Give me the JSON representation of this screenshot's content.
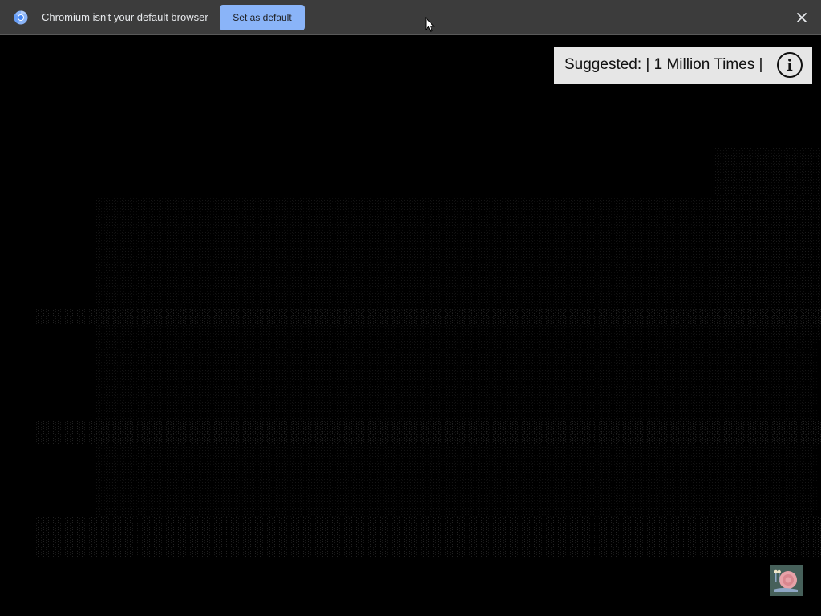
{
  "infobar": {
    "message": "Chromium isn't your default browser",
    "button_label": "Set as default",
    "close_icon": "close-icon",
    "logo_icon": "chromium-logo-icon"
  },
  "overlay": {
    "suggestion_text": "Suggested: | 1 Million Times |",
    "info_icon": "info-icon",
    "info_glyph": "i"
  },
  "colors": {
    "infobar_bg": "#3c3c3c",
    "button_bg": "#8ab4f8",
    "content_bg": "#000000",
    "suggestion_bg": "#e6e6e6"
  }
}
